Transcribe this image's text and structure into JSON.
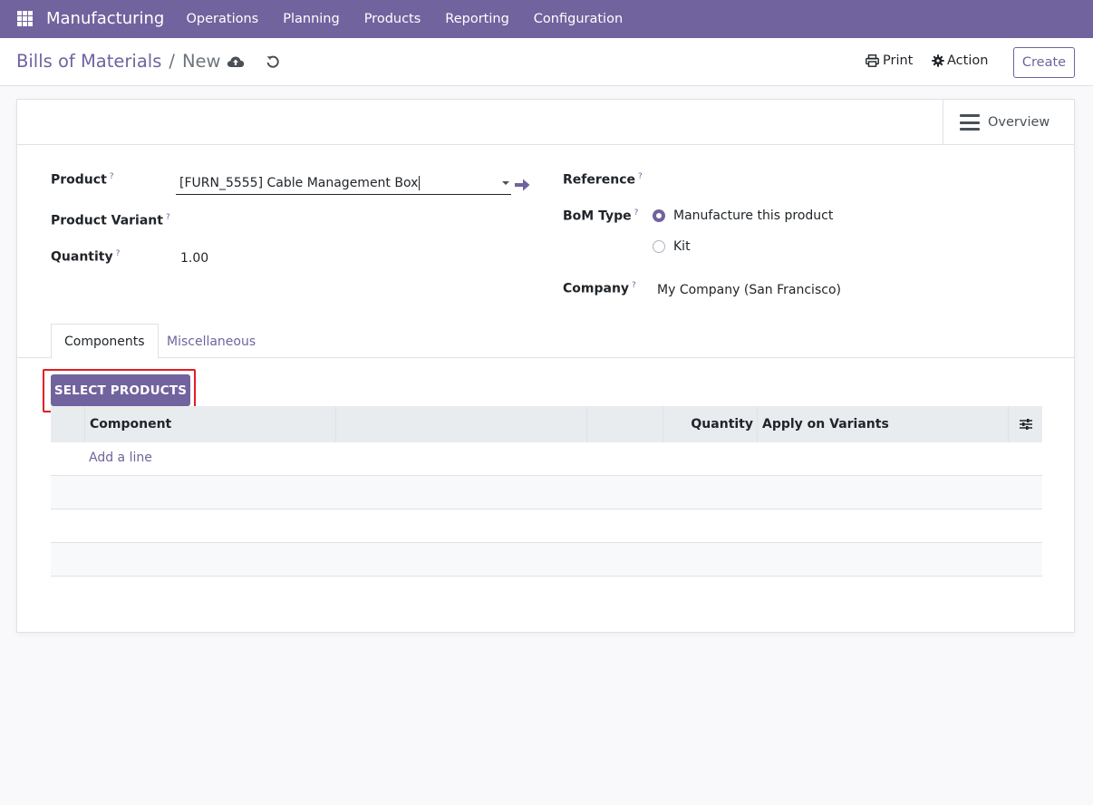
{
  "navbar": {
    "brand": "Manufacturing",
    "menu": [
      "Operations",
      "Planning",
      "Products",
      "Reporting",
      "Configuration"
    ]
  },
  "control": {
    "breadcrumb_parent": "Bills of Materials",
    "breadcrumb_separator": "/",
    "breadcrumb_current": "New",
    "print_label": "Print",
    "action_label": "Action",
    "create_label": "Create"
  },
  "button_box": {
    "overview_label": "Overview"
  },
  "form": {
    "product_label": "Product",
    "product_value": "[FURN_5555] Cable Management Box",
    "variant_label": "Product Variant",
    "quantity_label": "Quantity",
    "quantity_value": "1.00",
    "reference_label": "Reference",
    "bom_type_label": "BoM Type",
    "bom_type_options": [
      "Manufacture this product",
      "Kit"
    ],
    "bom_type_selected": "Manufacture this product",
    "company_label": "Company",
    "company_value": "My Company (San Francisco)",
    "help_mark": "?"
  },
  "tabs": [
    "Components",
    "Miscellaneous"
  ],
  "components": {
    "select_products_label": "SELECT PRODUCTS",
    "columns": [
      "Component",
      "",
      "",
      "Quantity",
      "Apply on Variants"
    ],
    "add_line_label": "Add a line"
  },
  "colors": {
    "brand": "#71639e",
    "highlight": "#e41b23"
  }
}
